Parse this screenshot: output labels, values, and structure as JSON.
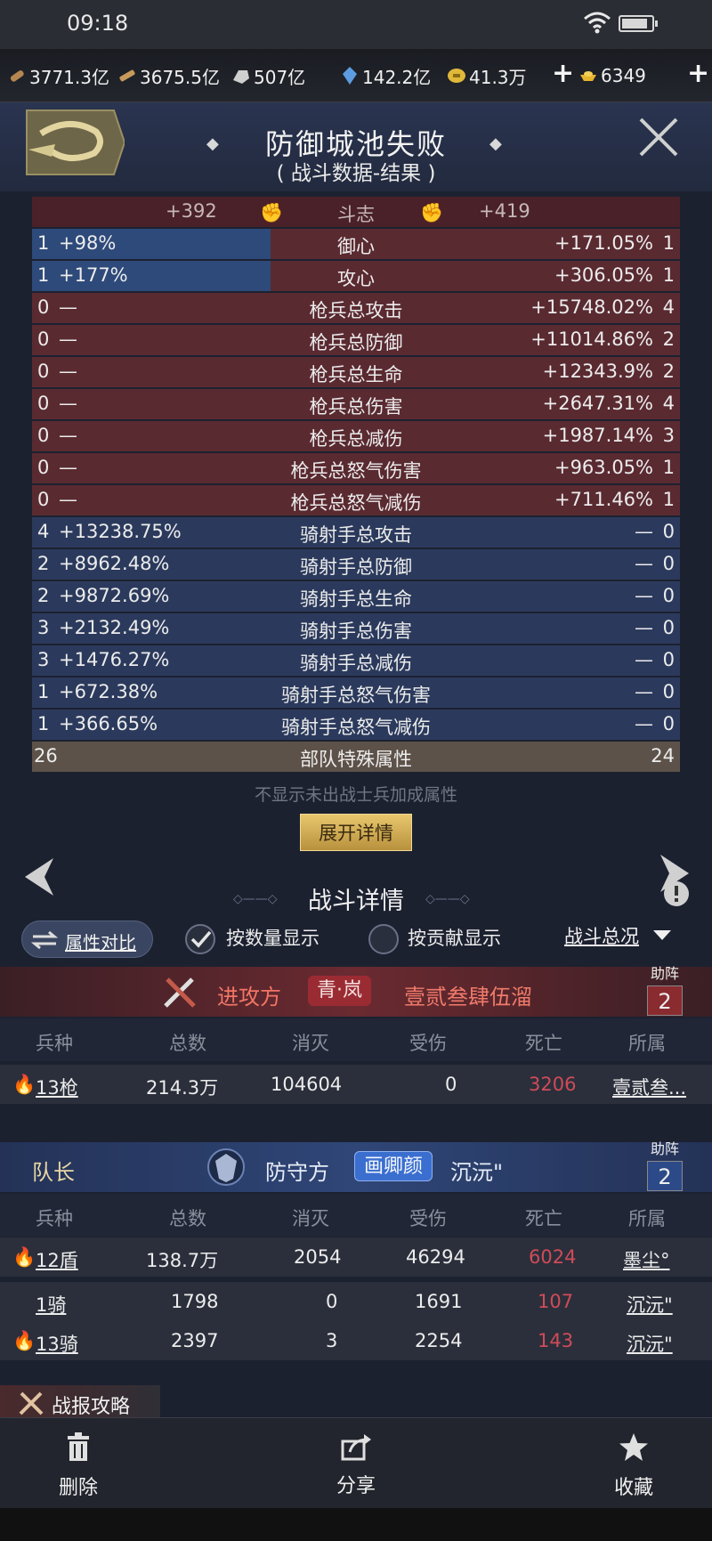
{
  "status": {
    "time": "09:18"
  },
  "resources": [
    {
      "icon": "wood-icon",
      "value": "3771.3亿"
    },
    {
      "icon": "stone-icon",
      "value": "3675.5亿"
    },
    {
      "icon": "iron-icon",
      "value": "507亿"
    },
    {
      "icon": "crystal-icon",
      "value": "142.2亿"
    },
    {
      "icon": "coin-icon",
      "value": "41.3万"
    },
    {
      "icon": "gold-ingot-icon",
      "value": "6349"
    }
  ],
  "header": {
    "title": "防御城池失败",
    "subtitle": "( 战斗数据-结果 )",
    "deco": "◆"
  },
  "stats": {
    "head": {
      "left": "+392",
      "label": "斗志",
      "right": "+419"
    },
    "rows": [
      {
        "style": "mixed",
        "lc": "1",
        "lv": "+98%",
        "label": "御心",
        "rv": "+171.05%",
        "rc": "1"
      },
      {
        "style": "mixed",
        "lc": "1",
        "lv": "+177%",
        "label": "攻心",
        "rv": "+306.05%",
        "rc": "1"
      },
      {
        "style": "red",
        "lc": "0",
        "lv": "—",
        "label": "枪兵总攻击",
        "rv": "+15748.02%",
        "rc": "4"
      },
      {
        "style": "red",
        "lc": "0",
        "lv": "—",
        "label": "枪兵总防御",
        "rv": "+11014.86%",
        "rc": "2"
      },
      {
        "style": "red",
        "lc": "0",
        "lv": "—",
        "label": "枪兵总生命",
        "rv": "+12343.9%",
        "rc": "2"
      },
      {
        "style": "red",
        "lc": "0",
        "lv": "—",
        "label": "枪兵总伤害",
        "rv": "+2647.31%",
        "rc": "4"
      },
      {
        "style": "red",
        "lc": "0",
        "lv": "—",
        "label": "枪兵总减伤",
        "rv": "+1987.14%",
        "rc": "3"
      },
      {
        "style": "red",
        "lc": "0",
        "lv": "—",
        "label": "枪兵总怒气伤害",
        "rv": "+963.05%",
        "rc": "1"
      },
      {
        "style": "red",
        "lc": "0",
        "lv": "—",
        "label": "枪兵总怒气减伤",
        "rv": "+711.46%",
        "rc": "1"
      },
      {
        "style": "blue",
        "lc": "4",
        "lv": "+13238.75%",
        "label": "骑射手总攻击",
        "rv": "—",
        "rc": "0"
      },
      {
        "style": "blue",
        "lc": "2",
        "lv": "+8962.48%",
        "label": "骑射手总防御",
        "rv": "—",
        "rc": "0"
      },
      {
        "style": "blue",
        "lc": "2",
        "lv": "+9872.69%",
        "label": "骑射手总生命",
        "rv": "—",
        "rc": "0"
      },
      {
        "style": "blue",
        "lc": "3",
        "lv": "+2132.49%",
        "label": "骑射手总伤害",
        "rv": "—",
        "rc": "0"
      },
      {
        "style": "blue",
        "lc": "3",
        "lv": "+1476.27%",
        "label": "骑射手总减伤",
        "rv": "—",
        "rc": "0"
      },
      {
        "style": "blue",
        "lc": "1",
        "lv": "+672.38%",
        "label": "骑射手总怒气伤害",
        "rv": "—",
        "rc": "0"
      },
      {
        "style": "blue",
        "lc": "1",
        "lv": "+366.65%",
        "label": "骑射手总怒气减伤",
        "rv": "—",
        "rc": "0"
      }
    ],
    "special": {
      "left": "26",
      "label": "部队特殊属性",
      "right": "24"
    }
  },
  "note": "不显示未出战士兵加成属性",
  "expand_label": "展开详情",
  "battle": {
    "title": "战斗详情",
    "attr_compare": "属性对比",
    "by_count": "按数量显示",
    "by_contrib": "按贡献显示",
    "overview": "战斗总况"
  },
  "attacker": {
    "side": "进攻方",
    "tag": "青·岚",
    "name": "壹贰叁肆伍溜",
    "help_label": "助阵",
    "help_count": "2"
  },
  "defender": {
    "captain": "队长",
    "side": "防守方",
    "tag": "画卿颜",
    "name": "沉沅\"",
    "help_label": "助阵",
    "help_count": "2"
  },
  "columns": [
    "兵种",
    "总数",
    "消灭",
    "受伤",
    "死亡",
    "所属"
  ],
  "attacker_rows": [
    {
      "unit": "13枪",
      "total": "214.3万",
      "kill": "104604",
      "hurt": "0",
      "dead": "3206",
      "owner": "壹贰叁..."
    }
  ],
  "defender_rows": [
    {
      "unit": "12盾",
      "total": "138.7万",
      "kill": "2054",
      "hurt": "46294",
      "dead": "6024",
      "owner": "墨尘°"
    },
    {
      "unit": "1骑",
      "total": "1798",
      "kill": "0",
      "hurt": "1691",
      "dead": "107",
      "owner": "沉沅\""
    },
    {
      "unit": "13骑",
      "total": "2397",
      "kill": "3",
      "hurt": "2254",
      "dead": "143",
      "owner": "沉沅\""
    }
  ],
  "strategy": "战报攻略",
  "bottom": {
    "delete": "删除",
    "share": "分享",
    "favorite": "收藏"
  }
}
